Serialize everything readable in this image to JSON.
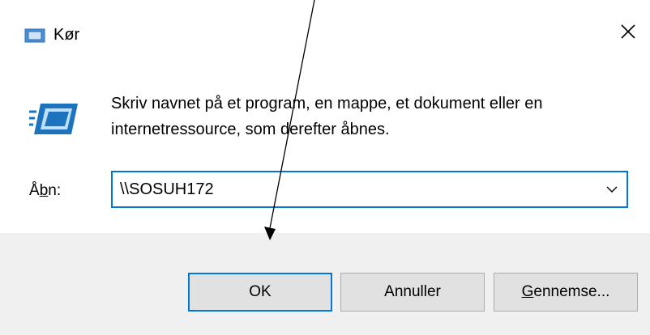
{
  "window": {
    "title": "Kør",
    "title_icon": "run-dialog-icon",
    "close_icon": "close-icon"
  },
  "content": {
    "icon": "run-program-icon",
    "description": "Skriv navnet på et program, en mappe, et dokument eller en internetressource, som derefter åbnes.",
    "open_label_prefix": "Å",
    "open_label_mnemonic": "b",
    "open_label_suffix": "n:",
    "open_value": "\\\\SOSUH172",
    "dropdown_icon": "chevron-down-icon"
  },
  "buttons": {
    "ok_label": "OK",
    "cancel_label": "Annuller",
    "browse_mnemonic": "G",
    "browse_rest": "ennemse..."
  },
  "colors": {
    "accent": "#0078d7",
    "footer_bg": "#f0f0f0",
    "button_bg": "#e1e1e1",
    "annotation_arrow": "#000000"
  },
  "annotation": {
    "type": "arrow",
    "points_to": "ok-button"
  }
}
